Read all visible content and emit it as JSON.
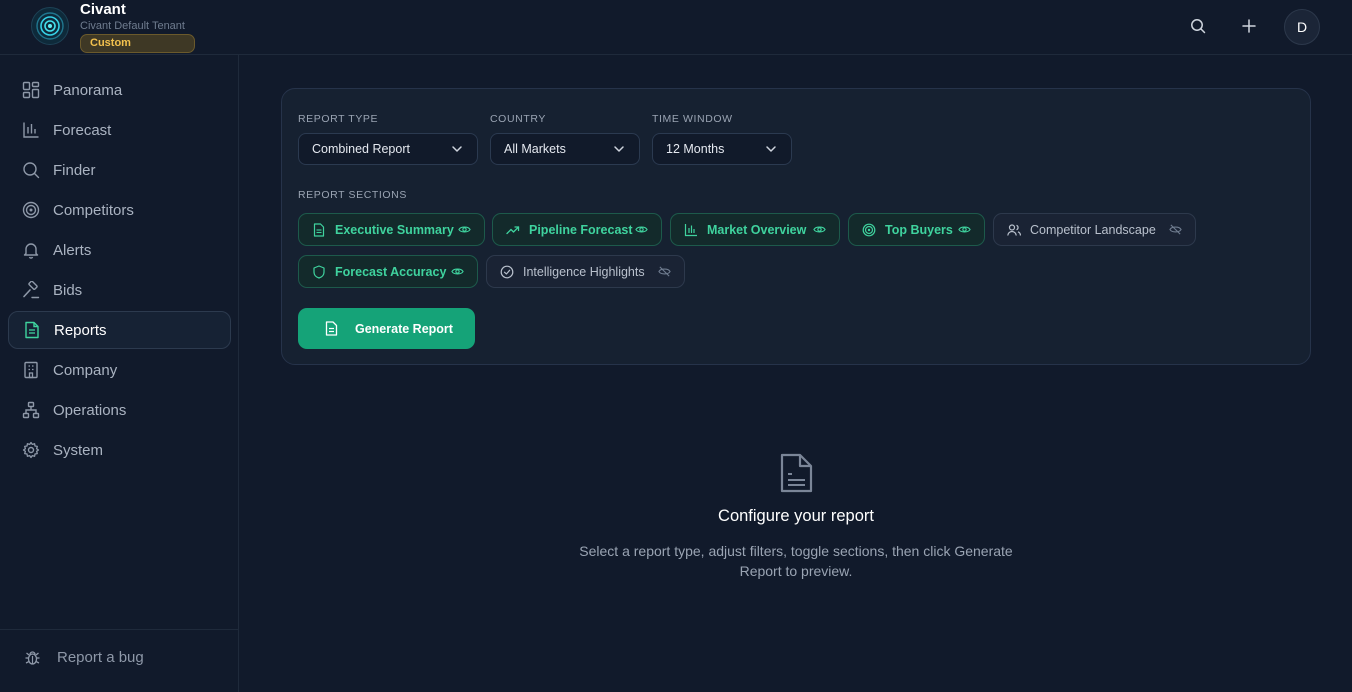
{
  "brand": {
    "name": "Civant",
    "tenant": "Civant Default Tenant",
    "badge": "Custom"
  },
  "header": {
    "avatar_initial": "D",
    "search_icon": "search-icon",
    "add_icon": "plus-icon"
  },
  "sidebar": {
    "items": [
      {
        "label": "Panorama",
        "icon": "dashboard-icon"
      },
      {
        "label": "Forecast",
        "icon": "bar-chart-icon"
      },
      {
        "label": "Finder",
        "icon": "search-icon"
      },
      {
        "label": "Competitors",
        "icon": "target-icon"
      },
      {
        "label": "Alerts",
        "icon": "bell-icon"
      },
      {
        "label": "Bids",
        "icon": "gavel-icon"
      },
      {
        "label": "Reports",
        "icon": "document-icon",
        "active": true
      },
      {
        "label": "Company",
        "icon": "building-icon"
      },
      {
        "label": "Operations",
        "icon": "network-icon"
      },
      {
        "label": "System",
        "icon": "gear-icon"
      }
    ],
    "footer": {
      "label": "Report a bug",
      "icon": "bug-icon"
    }
  },
  "report": {
    "type_label": "REPORT TYPE",
    "type_value": "Combined Report",
    "country_label": "COUNTRY",
    "country_value": "All Markets",
    "window_label": "TIME WINDOW",
    "window_value": "12 Months",
    "sections_label": "REPORT SECTIONS",
    "sections": [
      {
        "label": "Executive Summary",
        "enabled": true,
        "icon": "document-icon"
      },
      {
        "label": "Pipeline Forecast",
        "enabled": true,
        "icon": "trending-up-icon"
      },
      {
        "label": "Market Overview",
        "enabled": true,
        "icon": "bar-chart-icon"
      },
      {
        "label": "Top Buyers",
        "enabled": true,
        "icon": "target-icon"
      },
      {
        "label": "Competitor Landscape",
        "enabled": false,
        "icon": "users-icon"
      },
      {
        "label": "Forecast Accuracy",
        "enabled": true,
        "icon": "shield-icon"
      },
      {
        "label": "Intelligence Highlights",
        "enabled": false,
        "icon": "check-circle-icon"
      }
    ],
    "generate_label": "Generate Report"
  },
  "empty_state": {
    "title": "Configure your report",
    "description": "Select a report type, adjust filters, toggle sections, then click Generate Report to preview."
  },
  "colors": {
    "background": "#111a2b",
    "accent": "#15a378",
    "chip_on_text": "#3fd39e",
    "badge": "#f2c14e"
  }
}
